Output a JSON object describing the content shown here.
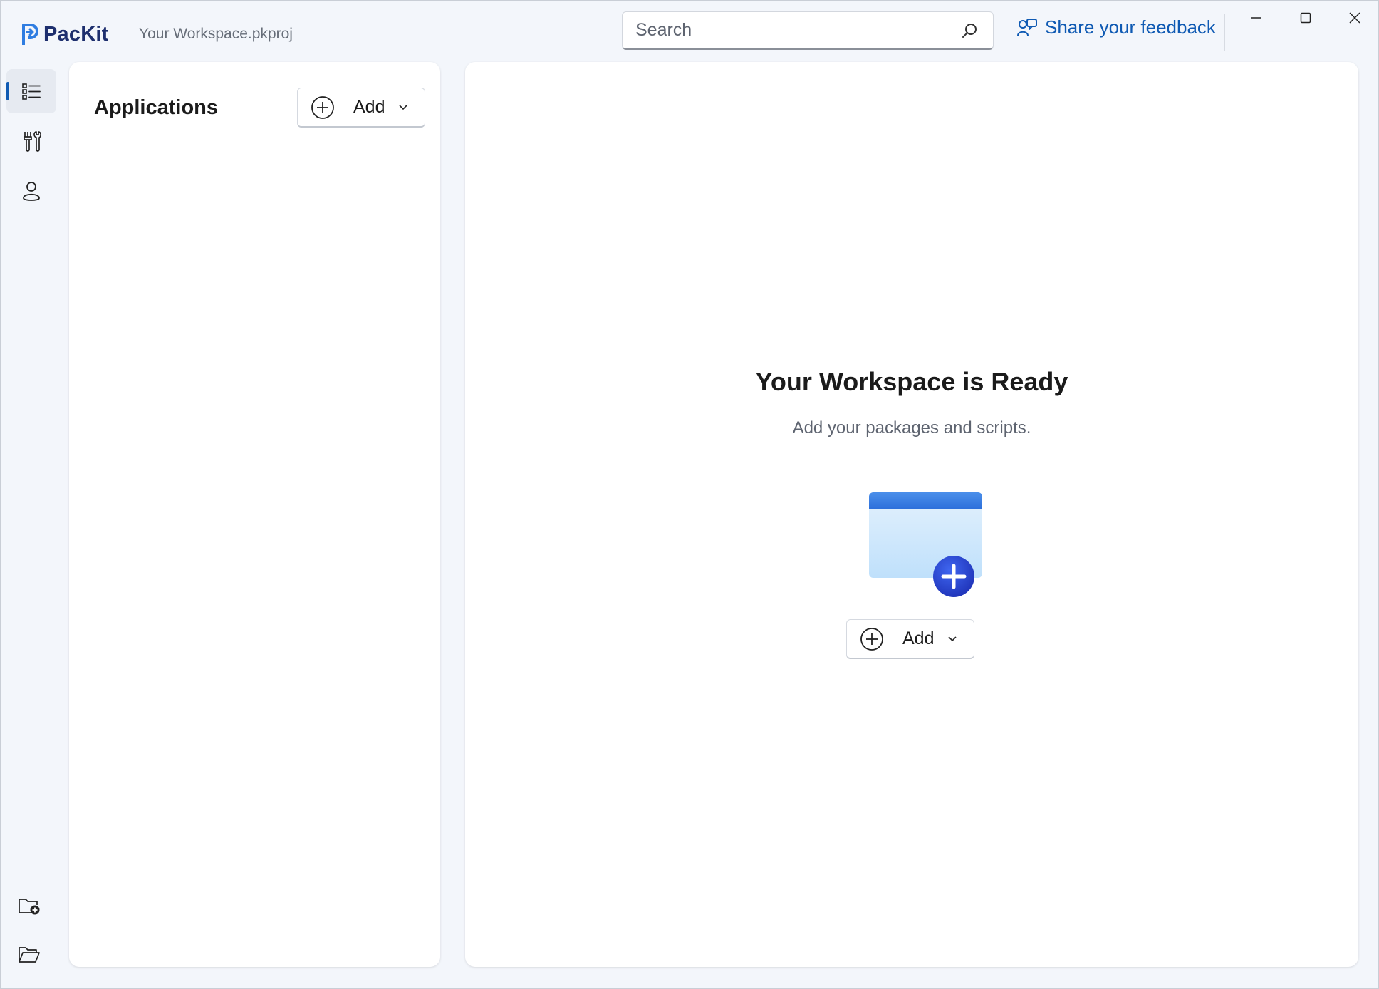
{
  "app": {
    "name": "PacKit",
    "document_title": "Your Workspace.pkproj"
  },
  "search": {
    "placeholder": "Search"
  },
  "feedback": {
    "label": "Share your feedback"
  },
  "colors": {
    "accent": "#0f5ab3",
    "brand": "#1e2f6e",
    "illustration_plus": "#2744d6"
  },
  "sidebar": {
    "items": [
      {
        "icon": "list-icon",
        "active": true
      },
      {
        "icon": "tools-icon",
        "active": false
      },
      {
        "icon": "person-icon",
        "active": false
      }
    ],
    "bottom": [
      {
        "icon": "new-folder-icon"
      },
      {
        "icon": "open-folder-icon"
      }
    ]
  },
  "applications_panel": {
    "title": "Applications",
    "add_label": "Add"
  },
  "main": {
    "empty_title": "Your Workspace is Ready",
    "empty_subtitle": "Add your packages and scripts.",
    "add_label": "Add"
  }
}
